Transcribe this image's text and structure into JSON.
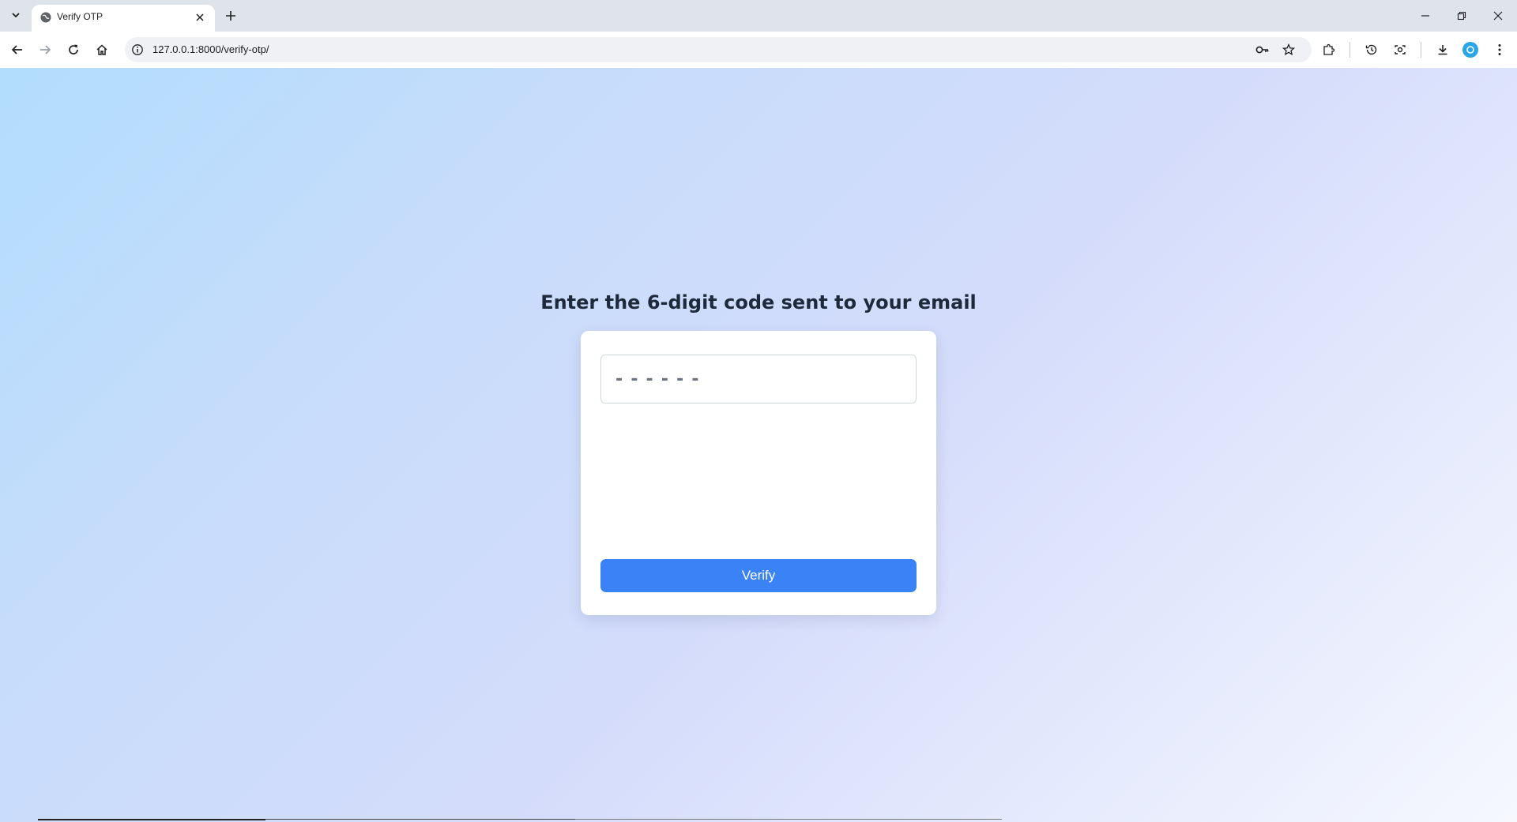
{
  "browser": {
    "tab": {
      "title": "Verify OTP"
    },
    "address_bar": {
      "url": "127.0.0.1:8000/verify-otp/"
    },
    "profile_color": "#2aa5e8"
  },
  "page": {
    "heading": "Enter the 6-digit code sent to your email",
    "otp_input": {
      "placeholder": "------",
      "value": ""
    },
    "verify_label": "Verify",
    "accent_color": "#3b82f6"
  }
}
